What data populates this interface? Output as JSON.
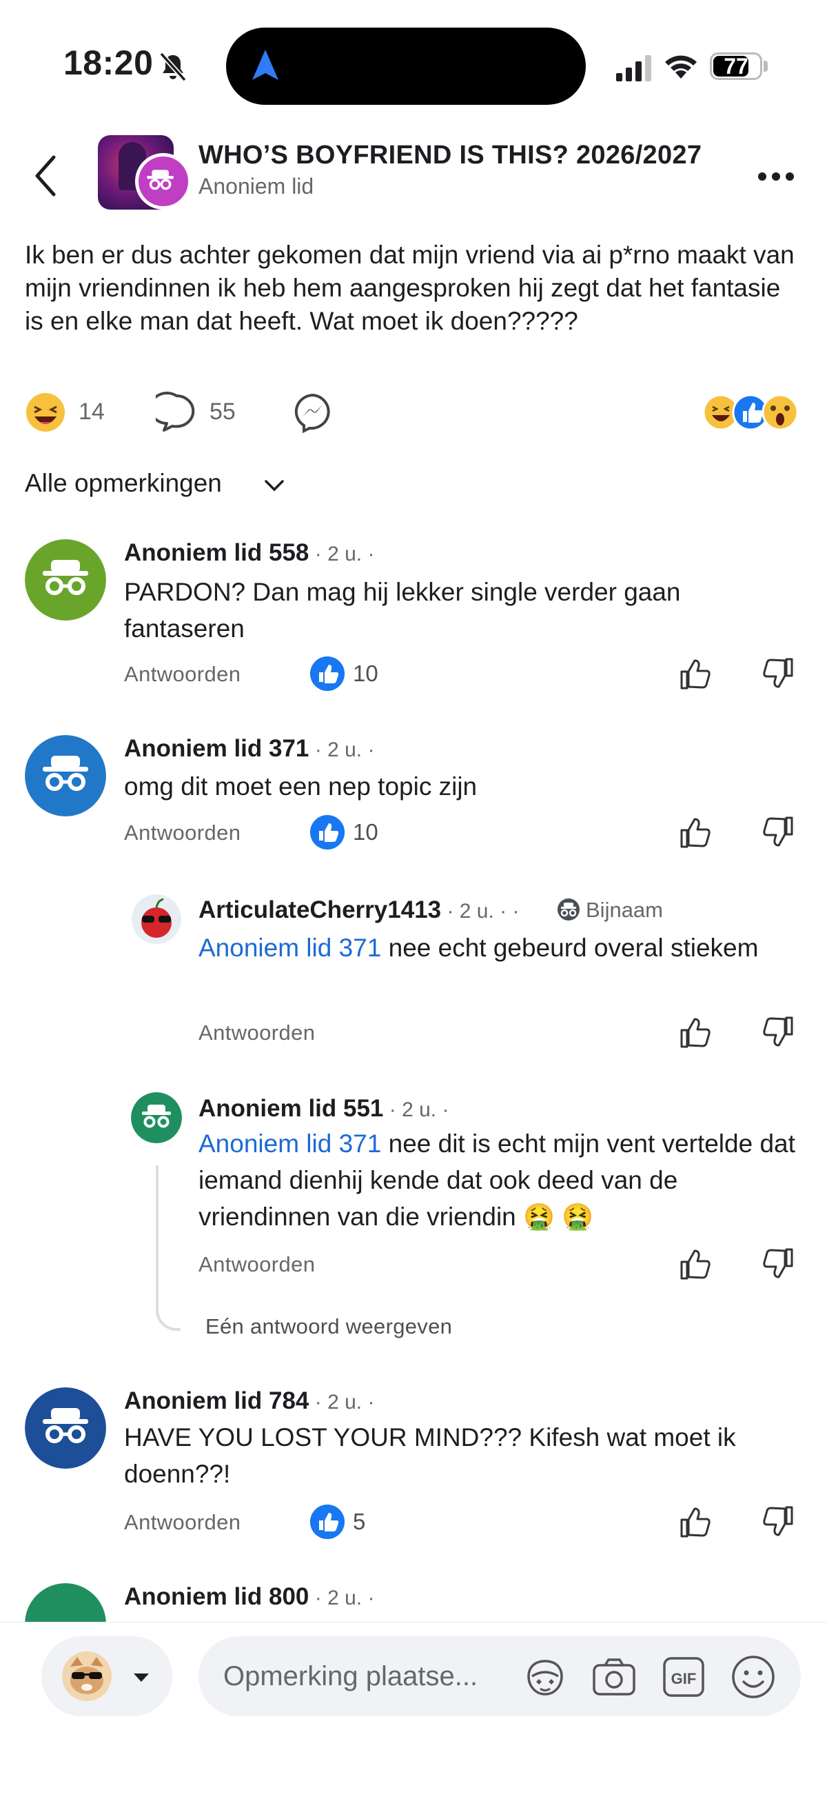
{
  "status_bar": {
    "time": "18:20",
    "battery": "77",
    "battery_level": 0.77
  },
  "post": {
    "group_title": "WHO’S BOYFRIEND IS THIS? 2026/2027",
    "author": "Anoniem lid",
    "body": "Ik ben er dus achter gekomen dat mijn vriend via ai p*rno maakt van mijn vriendinnen ik heb hem aangesproken hij zegt dat het fantasie is en elke man dat heeft. Wat moet ik doen?????",
    "reaction_count": "14",
    "comment_count": "55"
  },
  "sort": {
    "label": "Alle opmerkingen"
  },
  "comments": [
    {
      "name": "Anoniem lid 558",
      "meta": " · 2 u. ·",
      "text": "PARDON? Dan mag hij lekker single verder gaan fantaseren",
      "reply": "Antwoorden",
      "likes": "10",
      "avatar_color": "#6aa52b"
    },
    {
      "name": "Anoniem lid 371",
      "meta": " · 2 u. ·",
      "text": "omg dit moet een nep topic zijn",
      "reply": "Antwoorden",
      "likes": "10",
      "avatar_color": "#2178c8"
    },
    {
      "name": "ArticulateCherry1413",
      "meta": " · 2 u. · ·",
      "badge": "Bijnaam",
      "mention": "Anoniem lid 371",
      "text": " nee echt gebeurd overal stiekem",
      "reply": "Antwoorden"
    },
    {
      "name": "Anoniem lid 551",
      "meta": " · 2 u. ·",
      "mention": "Anoniem lid 371",
      "text": " nee dit is echt mijn vent vertelde dat iemand dienhij kende dat ook deed van de vriendinnen van die vriendin 🤮 🤮",
      "reply": "Antwoorden",
      "avatar_color": "#1f8f5f"
    },
    {
      "name": "Anoniem lid 784",
      "meta": " · 2 u. ·",
      "text": "HAVE YOU LOST YOUR MIND??? Kifesh wat moet ik doenn??!",
      "reply": "Antwoorden",
      "likes": "5",
      "avatar_color": "#1c4f98"
    },
    {
      "name": "Anoniem lid 800",
      "meta": " · 2 u. ·",
      "avatar_color": "#1f8f5f"
    }
  ],
  "show_replies": "Eén antwoord weergeven",
  "composer": {
    "placeholder": "Opmerking plaatse..."
  },
  "colors": {
    "like_blue": "#1877f2",
    "mention_blue": "#1b6ad6",
    "muted": "#65676b"
  }
}
